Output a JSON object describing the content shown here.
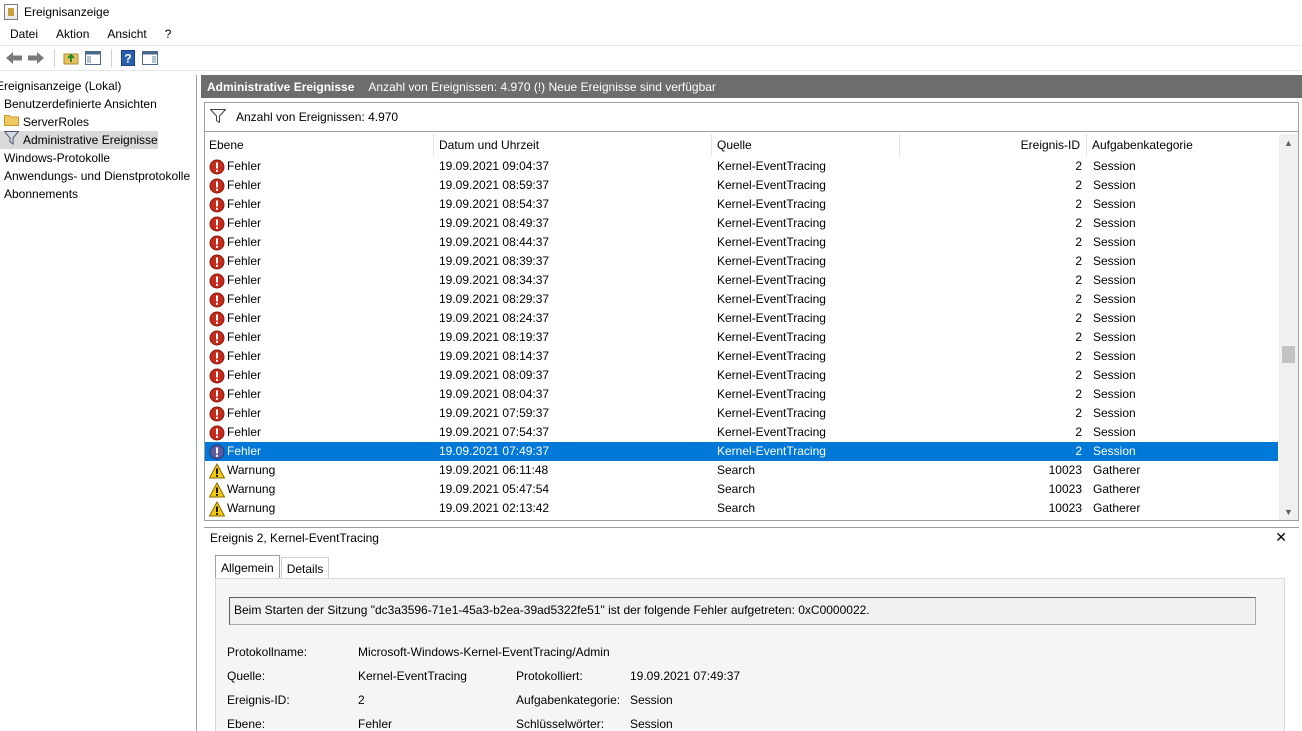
{
  "window": {
    "title": "Ereignisanzeige"
  },
  "menu": [
    "Datei",
    "Aktion",
    "Ansicht",
    "?"
  ],
  "toolbar": [
    "back-icon",
    "forward-icon",
    "folder-up-icon",
    "show-hide-tree-icon",
    "help-icon",
    "show-hide-action-pane-icon"
  ],
  "tree": {
    "items": [
      {
        "label": "Ereignisanzeige (Lokal)",
        "icon": ""
      },
      {
        "label": "Benutzerdefinierte Ansichten",
        "icon": ""
      },
      {
        "label": "ServerRoles",
        "icon": "folder"
      },
      {
        "label": "Administrative Ereignisse",
        "icon": "filter"
      },
      {
        "label": "Windows-Protokolle",
        "icon": ""
      },
      {
        "label": "Anwendungs- und Dienstprotokolle",
        "icon": ""
      },
      {
        "label": "Abonnements",
        "icon": ""
      }
    ]
  },
  "main": {
    "title": "Administrative Ereignisse",
    "status": "Anzahl von Ereignissen: 4.970 (!) Neue Ereignisse sind verfügbar",
    "filter_text": "Anzahl von Ereignissen: 4.970"
  },
  "table": {
    "columns": [
      "Ebene",
      "Datum und Uhrzeit",
      "Quelle",
      "Ereignis-ID",
      "Aufgabenkategorie"
    ],
    "rows": [
      {
        "level": "Fehler",
        "type": "error",
        "date": "19.09.2021 09:04:37",
        "source": "Kernel-EventTracing",
        "id": "2",
        "task": "Session"
      },
      {
        "level": "Fehler",
        "type": "error",
        "date": "19.09.2021 08:59:37",
        "source": "Kernel-EventTracing",
        "id": "2",
        "task": "Session"
      },
      {
        "level": "Fehler",
        "type": "error",
        "date": "19.09.2021 08:54:37",
        "source": "Kernel-EventTracing",
        "id": "2",
        "task": "Session"
      },
      {
        "level": "Fehler",
        "type": "error",
        "date": "19.09.2021 08:49:37",
        "source": "Kernel-EventTracing",
        "id": "2",
        "task": "Session"
      },
      {
        "level": "Fehler",
        "type": "error",
        "date": "19.09.2021 08:44:37",
        "source": "Kernel-EventTracing",
        "id": "2",
        "task": "Session"
      },
      {
        "level": "Fehler",
        "type": "error",
        "date": "19.09.2021 08:39:37",
        "source": "Kernel-EventTracing",
        "id": "2",
        "task": "Session"
      },
      {
        "level": "Fehler",
        "type": "error",
        "date": "19.09.2021 08:34:37",
        "source": "Kernel-EventTracing",
        "id": "2",
        "task": "Session"
      },
      {
        "level": "Fehler",
        "type": "error",
        "date": "19.09.2021 08:29:37",
        "source": "Kernel-EventTracing",
        "id": "2",
        "task": "Session"
      },
      {
        "level": "Fehler",
        "type": "error",
        "date": "19.09.2021 08:24:37",
        "source": "Kernel-EventTracing",
        "id": "2",
        "task": "Session"
      },
      {
        "level": "Fehler",
        "type": "error",
        "date": "19.09.2021 08:19:37",
        "source": "Kernel-EventTracing",
        "id": "2",
        "task": "Session"
      },
      {
        "level": "Fehler",
        "type": "error",
        "date": "19.09.2021 08:14:37",
        "source": "Kernel-EventTracing",
        "id": "2",
        "task": "Session"
      },
      {
        "level": "Fehler",
        "type": "error",
        "date": "19.09.2021 08:09:37",
        "source": "Kernel-EventTracing",
        "id": "2",
        "task": "Session"
      },
      {
        "level": "Fehler",
        "type": "error",
        "date": "19.09.2021 08:04:37",
        "source": "Kernel-EventTracing",
        "id": "2",
        "task": "Session"
      },
      {
        "level": "Fehler",
        "type": "error",
        "date": "19.09.2021 07:59:37",
        "source": "Kernel-EventTracing",
        "id": "2",
        "task": "Session"
      },
      {
        "level": "Fehler",
        "type": "error",
        "date": "19.09.2021 07:54:37",
        "source": "Kernel-EventTracing",
        "id": "2",
        "task": "Session"
      },
      {
        "level": "Fehler",
        "type": "error",
        "date": "19.09.2021 07:49:37",
        "source": "Kernel-EventTracing",
        "id": "2",
        "task": "Session",
        "selected": true
      },
      {
        "level": "Warnung",
        "type": "warning",
        "date": "19.09.2021 06:11:48",
        "source": "Search",
        "id": "10023",
        "task": "Gatherer"
      },
      {
        "level": "Warnung",
        "type": "warning",
        "date": "19.09.2021 05:47:54",
        "source": "Search",
        "id": "10023",
        "task": "Gatherer"
      },
      {
        "level": "Warnung",
        "type": "warning",
        "date": "19.09.2021 02:13:42",
        "source": "Search",
        "id": "10023",
        "task": "Gatherer"
      }
    ]
  },
  "detail": {
    "title": "Ereignis 2, Kernel-EventTracing",
    "tabs": [
      "Allgemein",
      "Details"
    ],
    "message": "Beim Starten der Sitzung \"dc3a3596-71e1-45a3-b2ea-39ad5322fe51\" ist der folgende Fehler aufgetreten: 0xC0000022.",
    "labels": {
      "protokollname": "Protokollname:",
      "quelle": "Quelle:",
      "ereignis_id": "Ereignis-ID:",
      "ebene": "Ebene:",
      "protokolliert": "Protokolliert:",
      "aufgabenkategorie": "Aufgabenkategorie:",
      "schluesselwoerter": "Schlüsselwörter:"
    },
    "values": {
      "protokollname": "Microsoft-Windows-Kernel-EventTracing/Admin",
      "quelle": "Kernel-EventTracing",
      "ereignis_id": "2",
      "ebene": "Fehler",
      "protokolliert": "19.09.2021 07:49:37",
      "aufgabenkategorie": "Session",
      "schluesselwoerter": "Session"
    }
  },
  "colors": {
    "header_bg": "#6d6d6d",
    "selection": "#0078d7",
    "error": "#c42b1c",
    "warning": "#f2c811"
  }
}
